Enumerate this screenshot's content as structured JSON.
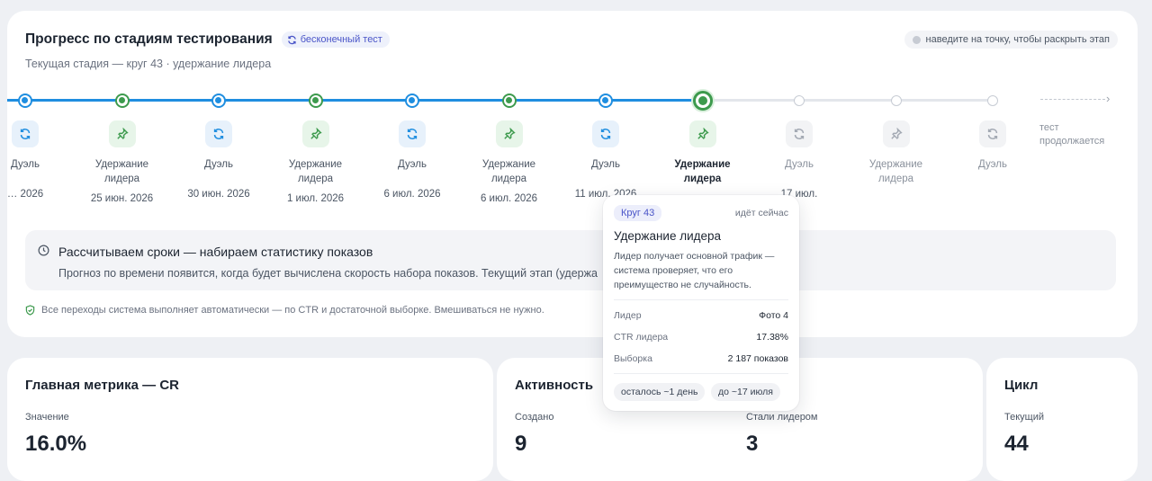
{
  "progress": {
    "title": "Прогресс по стадиям тестирования",
    "infinite_badge": "бесконечный тест",
    "hint": "наведите на точку, чтобы раскрыть этап",
    "subtitle": "Текущая стадия — круг 43 · удержание лидера",
    "stages": [
      {
        "label": "Дуэль",
        "date": "… 2026",
        "state": "done",
        "kind": "duel"
      },
      {
        "label": "Удержание лидера",
        "date": "25 июн. 2026",
        "state": "done",
        "kind": "hold"
      },
      {
        "label": "Дуэль",
        "date": "30 июн. 2026",
        "state": "done",
        "kind": "duel"
      },
      {
        "label": "Удержание лидера",
        "date": "1 июл. 2026",
        "state": "done",
        "kind": "hold"
      },
      {
        "label": "Дуэль",
        "date": "6 июл. 2026",
        "state": "done",
        "kind": "duel"
      },
      {
        "label": "Удержание лидера",
        "date": "6 июл. 2026",
        "state": "done",
        "kind": "hold"
      },
      {
        "label": "Дуэль",
        "date": "11 июл. 2026",
        "state": "done",
        "kind": "duel"
      },
      {
        "label": "Удержание лидера",
        "date": "",
        "state": "current",
        "kind": "hold"
      },
      {
        "label": "Дуэль",
        "date": "17 июл.",
        "state": "future",
        "kind": "duel"
      },
      {
        "label": "Удержание лидера",
        "date": "",
        "state": "future",
        "kind": "hold"
      },
      {
        "label": "Дуэль",
        "date": "",
        "state": "future",
        "kind": "duel"
      }
    ],
    "end_label": "тест продолжается",
    "notice_title": "Рассчитываем сроки — набираем статистику показов",
    "notice_text": "Прогноз по времени появится, когда будет вычислена скорость набора показов. Текущий этап (удержа",
    "auto_note": "Все переходы система выполняет автоматически — по CTR и достаточной выборке. Вмешиваться не нужно."
  },
  "tooltip": {
    "badge": "Круг 43",
    "status": "идёт сейчас",
    "title": "Удержание лидера",
    "description": "Лидер получает основной трафик — система проверяет, что его преимущество не случайность.",
    "rows": [
      {
        "key": "Лидер",
        "value": "Фото 4"
      },
      {
        "key": "CTR лидера",
        "value": "17.38%"
      },
      {
        "key": "Выборка",
        "value": "2 187 показов"
      }
    ],
    "chip_left": "осталось ~1 день",
    "chip_right": "до ~17 июля"
  },
  "main_metric": {
    "title": "Главная метрика — CR",
    "label": "Значение",
    "value": "16.0%"
  },
  "activity": {
    "title": "Активность",
    "created_label": "Создано",
    "created_value": "9",
    "leaders_label": "Стали лидером",
    "leaders_value": "3"
  },
  "cycle": {
    "title": "Цикл",
    "label": "Текущий",
    "value": "44"
  },
  "colors": {
    "blue": "#1f8ee0",
    "green": "#3d9a4d",
    "accent": "#4a55c8"
  }
}
